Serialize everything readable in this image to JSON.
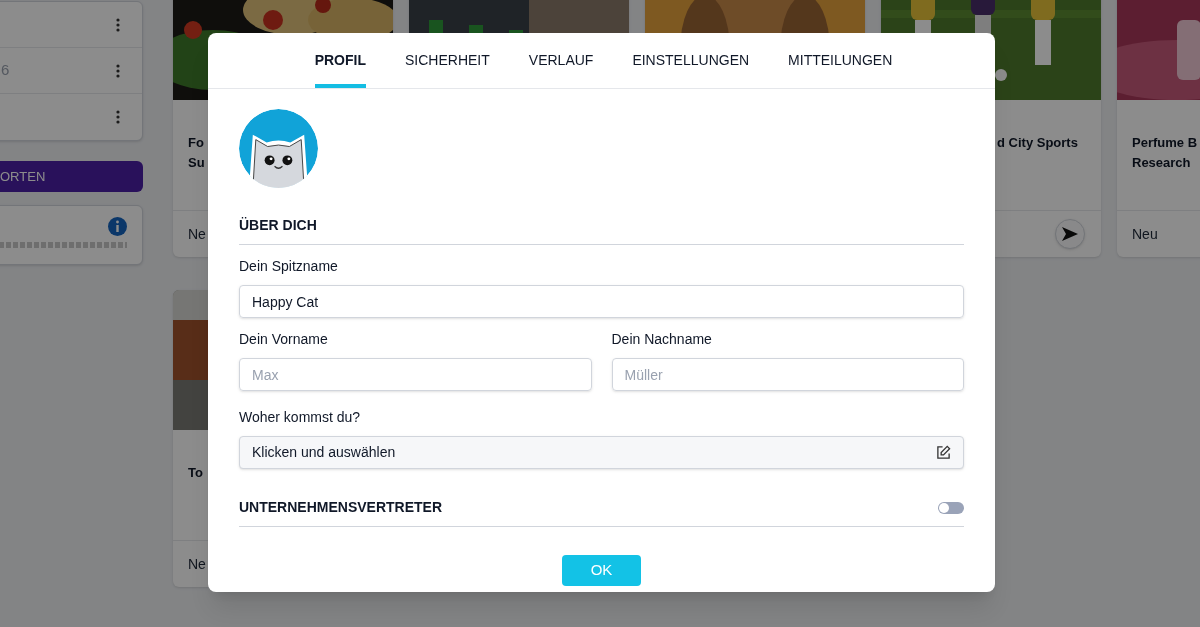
{
  "background": {
    "sidebar": {
      "rows": [
        {
          "kind": "menu"
        },
        {
          "kind": "text_menu",
          "text": "6"
        },
        {
          "kind": "menu"
        }
      ],
      "button": "ORTEN"
    },
    "card_rows": [
      [
        {
          "kind": "picture",
          "title_lines": [
            "Fo",
            "Su"
          ],
          "footer": "Ne"
        },
        {
          "kind": "picture"
        },
        {
          "kind": "picture"
        },
        {
          "kind": "picture",
          "title_lines": [
            "d City Sports"
          ],
          "send_button": true
        },
        {
          "kind": "picture",
          "title_lines": [
            "Perfume B",
            "Research"
          ],
          "footer": "Neu"
        }
      ],
      [
        {
          "kind": "picture",
          "title_lines": [
            "To"
          ],
          "footer": "Ne"
        }
      ]
    ]
  },
  "dialog": {
    "tabs": [
      {
        "label": "PROFIL",
        "selected": true
      },
      {
        "label": "SICHERHEIT",
        "selected": false
      },
      {
        "label": "VERLAUF",
        "selected": false
      },
      {
        "label": "EINSTELLUNGEN",
        "selected": false
      },
      {
        "label": "MITTEILUNGEN",
        "selected": false
      }
    ],
    "section_title": "ÜBER DICH",
    "nickname": {
      "label": "Dein Spitzname",
      "value": "Happy Cat"
    },
    "first_name": {
      "label": "Dein Vorname",
      "placeholder": "Max"
    },
    "last_name": {
      "label": "Dein Nachname",
      "placeholder": "Müller"
    },
    "origin": {
      "label": "Woher kommst du?",
      "prompt": "Klicken und auswählen"
    },
    "company_rep": {
      "label": "UNTERNEHMENSVERTRETER",
      "on": false
    },
    "ok_button": "OK"
  }
}
